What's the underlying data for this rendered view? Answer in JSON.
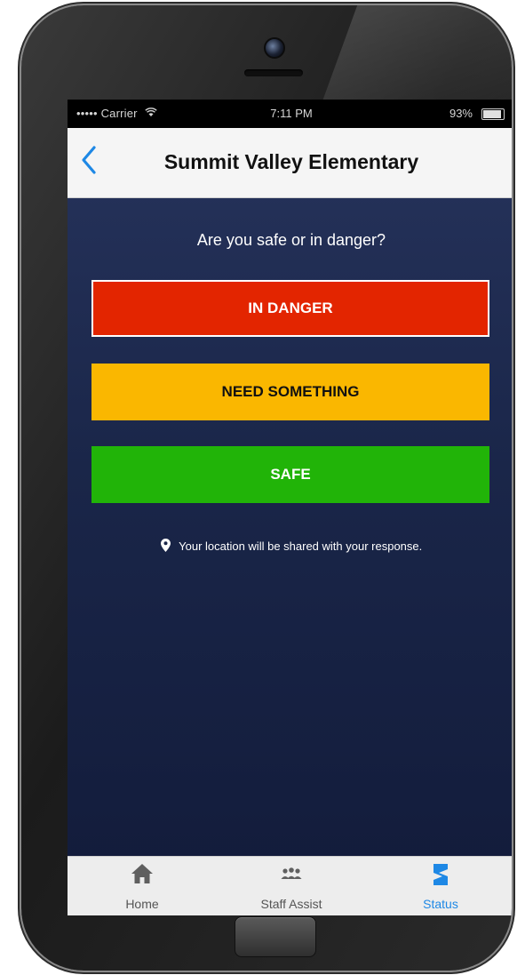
{
  "status_bar": {
    "carrier": "••••• Carrier",
    "time": "7:11 PM",
    "battery": "93%"
  },
  "nav": {
    "title": "Summit Valley Elementary",
    "back_icon": "chevron-left-icon"
  },
  "main": {
    "prompt": "Are you safe or in danger?",
    "buttons": {
      "danger": "IN DANGER",
      "need": "NEED SOMETHING",
      "safe": "SAFE"
    },
    "location_note": "Your location will be shared with your response."
  },
  "tabs": [
    {
      "label": "Home",
      "icon": "home-icon",
      "active": false
    },
    {
      "label": "Staff Assist",
      "icon": "people-icon",
      "active": false
    },
    {
      "label": "Status",
      "icon": "status-icon",
      "active": true
    }
  ],
  "colors": {
    "danger": "#e32500",
    "need": "#fab700",
    "safe": "#21b408",
    "accent": "#1e88e5",
    "background": "#1a2649"
  }
}
